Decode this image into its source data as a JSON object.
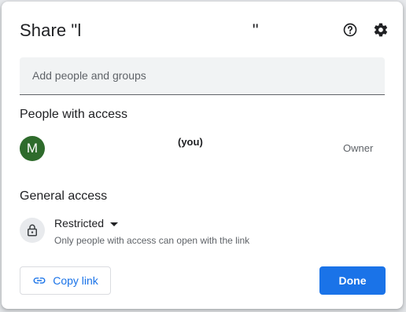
{
  "dialog": {
    "title": "Share \"l                                   \"",
    "help_icon": "help-circle-icon",
    "settings_icon": "gear-icon"
  },
  "add_people": {
    "placeholder": "Add people and groups",
    "value": ""
  },
  "people_with_access": {
    "heading": "People with access",
    "people": [
      {
        "avatar_letter": "M",
        "avatar_color": "#2e6b2c",
        "name_suffix": "(you)",
        "role": "Owner"
      }
    ]
  },
  "general_access": {
    "heading": "General access",
    "icon": "lock-icon",
    "level": "Restricted",
    "description": "Only people with access can open with the link"
  },
  "actions": {
    "copy_link_label": "Copy link",
    "copy_link_icon": "link-icon",
    "done_label": "Done"
  },
  "colors": {
    "accent": "#1a73e8",
    "text_primary": "#202124",
    "text_secondary": "#5f6368"
  }
}
